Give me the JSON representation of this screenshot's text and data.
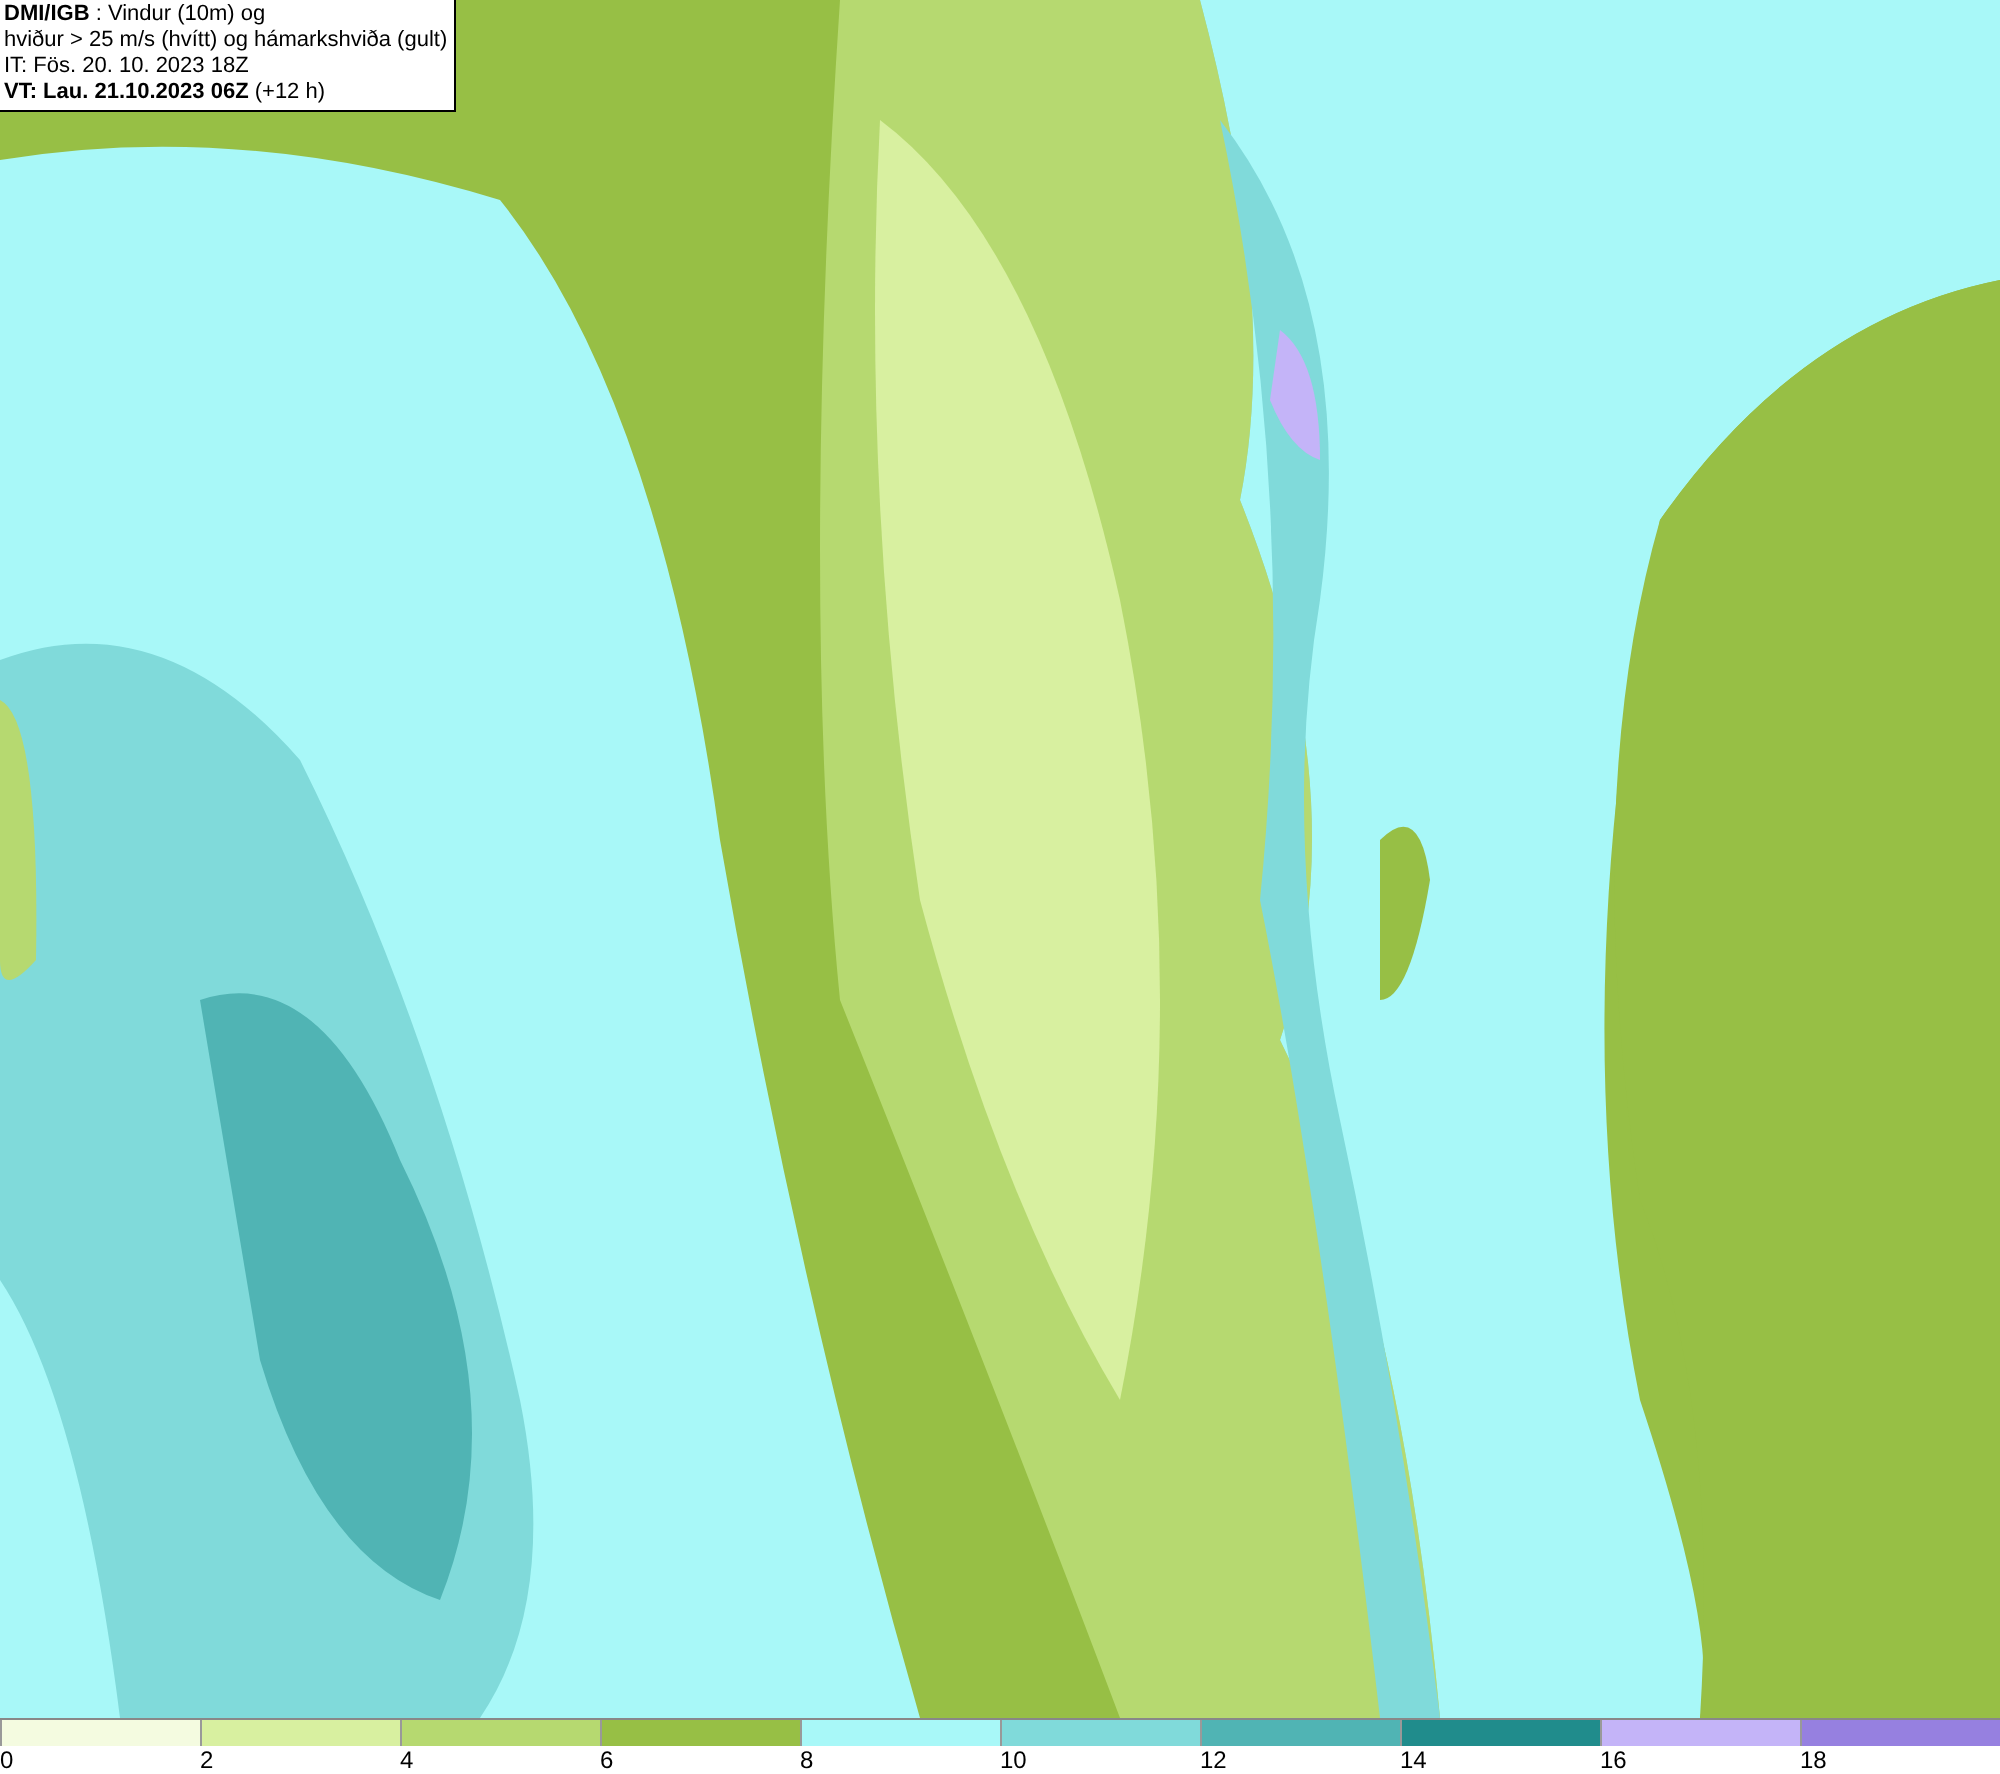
{
  "title_box": {
    "lines": [
      "**DMI/IGB** : Vindur (10m) og",
      "hviður > 25 m/s (hvítt) og hámarkshviða (gult)",
      "IT: Fös. 20. 10. 2023 18Z",
      "**VT: Lau. 21.10.2023 06Z** (+12 h)"
    ]
  },
  "legend": [
    {
      "label": "0",
      "color": "#f4fbe0"
    },
    {
      "label": "2",
      "color": "#d8f0a0"
    },
    {
      "label": "4",
      "color": "#b6d970"
    },
    {
      "label": "6",
      "color": "#97bf45"
    },
    {
      "label": "8",
      "color": "#a8f8f8"
    },
    {
      "label": "10",
      "color": "#80dada"
    },
    {
      "label": "12",
      "color": "#50b4b4"
    },
    {
      "label": "14",
      "color": "#208c8c"
    },
    {
      "label": "16",
      "color": "#c4b4f8"
    },
    {
      "label": "18",
      "color": "#9680e0"
    }
  ]
}
